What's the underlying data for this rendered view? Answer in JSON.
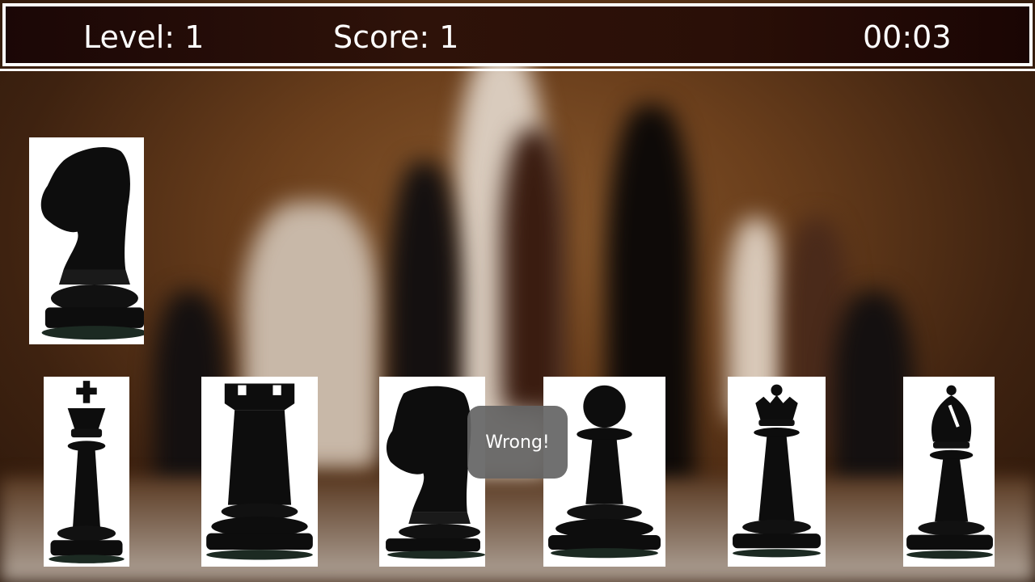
{
  "hud": {
    "level_label": "Level: 1",
    "score_label": "Score: 1",
    "timer": "00:03"
  },
  "target_piece": {
    "name": "knight",
    "icon": "knight-icon"
  },
  "choices": [
    {
      "name": "king",
      "icon": "king-icon"
    },
    {
      "name": "rook",
      "icon": "rook-icon"
    },
    {
      "name": "knight",
      "icon": "knight-icon"
    },
    {
      "name": "pawn",
      "icon": "pawn-icon"
    },
    {
      "name": "queen",
      "icon": "queen-icon"
    },
    {
      "name": "bishop",
      "icon": "bishop-icon"
    }
  ],
  "toast": {
    "message": "Wrong!"
  },
  "colors": {
    "hud_text": "#ffffff",
    "piece": "#0d0d0d",
    "card_bg": "#ffffff"
  }
}
